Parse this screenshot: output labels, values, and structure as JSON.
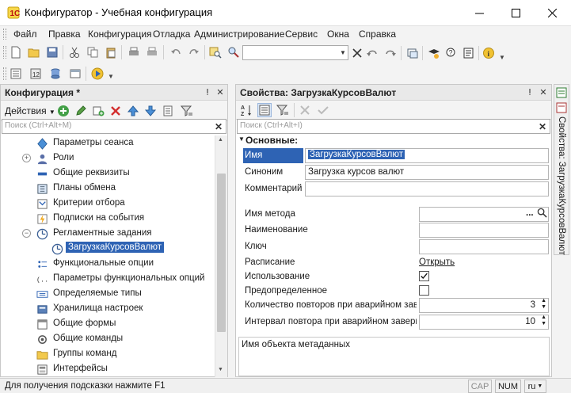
{
  "window": {
    "title": "Конфигуратор - Учебная конфигурация"
  },
  "menu": [
    "Файл",
    "Правка",
    "Конфигурация",
    "Отладка",
    "Администрирование",
    "Сервис",
    "Окна",
    "Справка"
  ],
  "config_panel": {
    "title": "Конфигурация *",
    "actions_label": "Действия",
    "search_placeholder": "Поиск (Ctrl+Alt+M)",
    "tree": [
      {
        "label": "Параметры сеанса",
        "icon": "session-params-icon"
      },
      {
        "label": "Роли",
        "icon": "roles-icon"
      },
      {
        "label": "Общие реквизиты",
        "icon": "common-attributes-icon"
      },
      {
        "label": "Планы обмена",
        "icon": "exchange-plans-icon"
      },
      {
        "label": "Критерии отбора",
        "icon": "filter-criteria-icon"
      },
      {
        "label": "Подписки на события",
        "icon": "event-subscriptions-icon"
      },
      {
        "label": "Регламентные задания",
        "icon": "scheduled-jobs-icon"
      },
      {
        "label": "ЗагрузкаКурсовВалют",
        "icon": "scheduled-job-icon"
      },
      {
        "label": "Функциональные опции",
        "icon": "functional-options-icon"
      },
      {
        "label": "Параметры функциональных опций",
        "icon": "functional-option-params-icon"
      },
      {
        "label": "Определяемые типы",
        "icon": "defined-types-icon"
      },
      {
        "label": "Хранилища настроек",
        "icon": "settings-storages-icon"
      },
      {
        "label": "Общие формы",
        "icon": "common-forms-icon"
      },
      {
        "label": "Общие команды",
        "icon": "common-commands-icon"
      },
      {
        "label": "Группы команд",
        "icon": "command-groups-icon"
      },
      {
        "label": "Интерфейсы",
        "icon": "interfaces-icon"
      }
    ]
  },
  "props_panel": {
    "title": "Свойства: ЗагрузкаКурсовВалют",
    "search_placeholder": "Поиск (Ctrl+Alt+I)",
    "section": "Основные:",
    "name_label": "Имя",
    "name_value": "ЗагрузкаКурсовВалют",
    "synonym_label": "Синоним",
    "synonym_value": "Загрузка курсов валют",
    "comment_label": "Комментарий",
    "method_label": "Имя метода",
    "naming_label": "Наименование",
    "key_label": "Ключ",
    "schedule_label": "Расписание",
    "schedule_link": "Открыть",
    "usage_label": "Использование",
    "usage_checked": true,
    "predefined_label": "Предопределенное",
    "predefined_checked": false,
    "retry_count_label": "Количество повторов при аварийном заве",
    "retry_count_value": "3",
    "retry_interval_label": "Интервал повтора при аварийном заверш",
    "retry_interval_value": "10",
    "description": "Имя объекта метаданных",
    "side_tab": "Свойства: ЗагрузкаКурсовВалют"
  },
  "status": {
    "hint": "Для получения подсказки нажмите F1",
    "cap": "CAP",
    "num": "NUM",
    "lang": "ru"
  }
}
